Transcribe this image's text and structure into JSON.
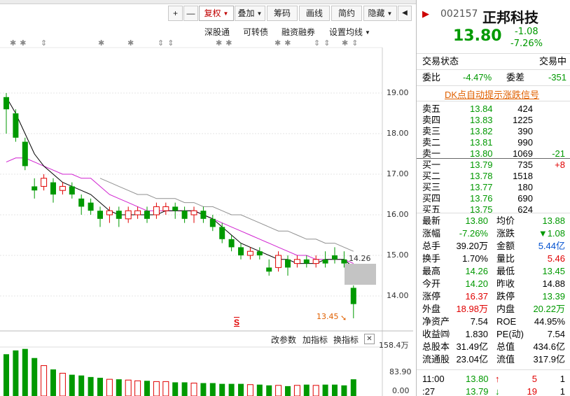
{
  "toolbar": {
    "plus": "+",
    "minus": "—",
    "restore": "复权",
    "overlay": "叠加",
    "chips": "筹码",
    "draw": "画线",
    "brief": "简约",
    "hide": "隐藏"
  },
  "subbar": {
    "sz_connect": "深股通",
    "convertible": "可转债",
    "margin": "融资融券",
    "ma_settings": "设置均线"
  },
  "chart": {
    "y_ticks": [
      "19.00",
      "18.00",
      "17.00",
      "16.00",
      "15.00",
      "14.00"
    ],
    "last_price_label": "14.26",
    "low_label": "13.45",
    "marker": "S",
    "volume_y_ticks": [
      "158.4万",
      "83.90",
      "0.00"
    ],
    "colors": {
      "up": "#e00000",
      "down": "#009900",
      "ma5": "#000000",
      "ma10": "#d020d0",
      "ma20": "#909090"
    },
    "candles": [
      {
        "o": 18.9,
        "c": 18.6,
        "h": 19.0,
        "l": 18.0,
        "up": false
      },
      {
        "o": 18.5,
        "c": 17.9,
        "h": 18.6,
        "l": 17.8,
        "up": false
      },
      {
        "o": 17.8,
        "c": 17.2,
        "h": 17.9,
        "l": 17.1,
        "up": false
      },
      {
        "o": 16.7,
        "c": 16.6,
        "h": 16.9,
        "l": 16.4,
        "up": false
      },
      {
        "o": 16.7,
        "c": 16.9,
        "h": 17.0,
        "l": 16.6,
        "up": true
      },
      {
        "o": 16.8,
        "c": 16.5,
        "h": 16.9,
        "l": 16.3,
        "up": false
      },
      {
        "o": 16.6,
        "c": 16.7,
        "h": 16.8,
        "l": 16.5,
        "up": true
      },
      {
        "o": 16.7,
        "c": 16.5,
        "h": 16.8,
        "l": 16.4,
        "up": false
      },
      {
        "o": 16.4,
        "c": 16.2,
        "h": 16.5,
        "l": 16.0,
        "up": false
      },
      {
        "o": 16.3,
        "c": 16.1,
        "h": 16.4,
        "l": 16.0,
        "up": false
      },
      {
        "o": 16.1,
        "c": 15.9,
        "h": 16.2,
        "l": 15.7,
        "up": false
      },
      {
        "o": 16.0,
        "c": 16.1,
        "h": 16.2,
        "l": 15.8,
        "up": true
      },
      {
        "o": 16.1,
        "c": 15.9,
        "h": 16.2,
        "l": 15.7,
        "up": false
      },
      {
        "o": 15.9,
        "c": 16.1,
        "h": 16.2,
        "l": 15.8,
        "up": true
      },
      {
        "o": 16.0,
        "c": 16.1,
        "h": 16.2,
        "l": 15.9,
        "up": true
      },
      {
        "o": 16.1,
        "c": 15.9,
        "h": 16.2,
        "l": 15.8,
        "up": false
      },
      {
        "o": 16.0,
        "c": 16.2,
        "h": 16.3,
        "l": 15.9,
        "up": true
      },
      {
        "o": 16.1,
        "c": 16.2,
        "h": 16.3,
        "l": 16.0,
        "up": true
      },
      {
        "o": 16.2,
        "c": 16.1,
        "h": 16.3,
        "l": 15.9,
        "up": false
      },
      {
        "o": 16.1,
        "c": 15.9,
        "h": 16.2,
        "l": 15.8,
        "up": false
      },
      {
        "o": 16.0,
        "c": 16.1,
        "h": 16.2,
        "l": 15.8,
        "up": true
      },
      {
        "o": 16.1,
        "c": 15.9,
        "h": 16.2,
        "l": 15.8,
        "up": false
      },
      {
        "o": 15.9,
        "c": 15.7,
        "h": 16.0,
        "l": 15.6,
        "up": false
      },
      {
        "o": 15.7,
        "c": 15.4,
        "h": 15.8,
        "l": 15.3,
        "up": false
      },
      {
        "o": 15.4,
        "c": 15.2,
        "h": 15.5,
        "l": 15.1,
        "up": false
      },
      {
        "o": 15.2,
        "c": 15.0,
        "h": 15.3,
        "l": 14.9,
        "up": false
      },
      {
        "o": 15.0,
        "c": 15.1,
        "h": 15.2,
        "l": 14.9,
        "up": true
      },
      {
        "o": 15.1,
        "c": 15.0,
        "h": 15.2,
        "l": 14.9,
        "up": false
      },
      {
        "o": 14.7,
        "c": 14.6,
        "h": 14.9,
        "l": 14.5,
        "up": false
      },
      {
        "o": 14.7,
        "c": 15.0,
        "h": 15.1,
        "l": 14.6,
        "up": true
      },
      {
        "o": 14.9,
        "c": 14.7,
        "h": 15.0,
        "l": 14.5,
        "up": false
      },
      {
        "o": 14.8,
        "c": 14.9,
        "h": 15.0,
        "l": 14.7,
        "up": true
      },
      {
        "o": 14.9,
        "c": 14.8,
        "h": 15.0,
        "l": 14.7,
        "up": false
      },
      {
        "o": 14.8,
        "c": 14.9,
        "h": 15.0,
        "l": 14.7,
        "up": true
      },
      {
        "o": 14.9,
        "c": 14.8,
        "h": 15.1,
        "l": 14.7,
        "up": false
      },
      {
        "o": 15.0,
        "c": 14.9,
        "h": 15.2,
        "l": 14.8,
        "up": false
      },
      {
        "o": 14.9,
        "c": 14.8,
        "h": 15.1,
        "l": 14.7,
        "up": false
      },
      {
        "o": 14.2,
        "c": 13.8,
        "h": 14.26,
        "l": 13.45,
        "up": false
      }
    ],
    "ma5": [
      18.9,
      18.5,
      18.0,
      17.5,
      17.2,
      17.0,
      16.8,
      16.7,
      16.6,
      16.5,
      16.3,
      16.1,
      16.0,
      16.0,
      16.0,
      16.0,
      16.0,
      16.1,
      16.1,
      16.1,
      16.1,
      16.0,
      15.9,
      15.7,
      15.5,
      15.3,
      15.2,
      15.1,
      15.0,
      14.9,
      14.9,
      14.8,
      14.8,
      14.8,
      14.9,
      14.9,
      14.9,
      14.7
    ],
    "ma10": [
      17.3,
      17.4,
      17.4,
      17.3,
      17.2,
      17.1,
      17.0,
      17.0,
      16.9,
      16.9,
      16.7,
      16.5,
      16.4,
      16.3,
      16.2,
      16.1,
      16.1,
      16.1,
      16.1,
      16.1,
      16.1,
      16.0,
      15.9,
      15.8,
      15.7,
      15.6,
      15.5,
      15.4,
      15.3,
      15.2,
      15.1,
      15.0,
      15.0,
      14.9,
      14.9,
      14.9,
      14.9,
      14.8
    ],
    "ma20": [
      null,
      null,
      null,
      null,
      null,
      null,
      null,
      null,
      null,
      null,
      16.9,
      16.8,
      16.7,
      16.6,
      16.5,
      16.5,
      16.4,
      16.4,
      16.4,
      16.3,
      16.3,
      16.2,
      16.2,
      16.1,
      16.0,
      16.0,
      15.9,
      15.8,
      15.7,
      15.6,
      15.6,
      15.5,
      15.4,
      15.4,
      15.3,
      15.3,
      15.2,
      15.1
    ],
    "volumes": [
      55,
      60,
      62,
      50,
      40,
      35,
      30,
      28,
      27,
      25,
      24,
      22,
      22,
      21,
      20,
      20,
      19,
      19,
      18,
      18,
      17,
      17,
      17,
      16,
      16,
      16,
      15,
      15,
      14,
      14,
      13,
      14,
      15,
      14,
      15,
      15,
      14,
      22
    ]
  },
  "vol_bar": {
    "change_params": "改参数",
    "add_indicator": "加指标",
    "swap_indicator": "换指标",
    "close": "✕"
  },
  "quote": {
    "code": "002157",
    "name": "正邦科技",
    "price": "13.80",
    "change": "-1.08",
    "change_pct": "-7.26%",
    "trade_status_label": "交易状态",
    "trade_status_value": "交易中",
    "weibi_label": "委比",
    "weibi_value": "-4.47%",
    "weicha_label": "委差",
    "weicha_value": "-351",
    "dk_link": "DK点自动提示涨跌信号"
  },
  "sell_orders": [
    {
      "label": "卖五",
      "price": "13.84",
      "vol": "424",
      "chg": ""
    },
    {
      "label": "卖四",
      "price": "13.83",
      "vol": "1225",
      "chg": ""
    },
    {
      "label": "卖三",
      "price": "13.82",
      "vol": "390",
      "chg": ""
    },
    {
      "label": "卖二",
      "price": "13.81",
      "vol": "990",
      "chg": ""
    },
    {
      "label": "卖一",
      "price": "13.80",
      "vol": "1069",
      "chg": "-21"
    }
  ],
  "buy_orders": [
    {
      "label": "买一",
      "price": "13.79",
      "vol": "735",
      "chg": "+8"
    },
    {
      "label": "买二",
      "price": "13.78",
      "vol": "1518",
      "chg": ""
    },
    {
      "label": "买三",
      "price": "13.77",
      "vol": "180",
      "chg": ""
    },
    {
      "label": "买四",
      "price": "13.76",
      "vol": "690",
      "chg": ""
    },
    {
      "label": "买五",
      "price": "13.75",
      "vol": "624",
      "chg": ""
    }
  ],
  "stats": [
    {
      "l1": "最新",
      "v1": "13.80",
      "c1": "green",
      "l2": "均价",
      "v2": "13.88",
      "c2": "green"
    },
    {
      "l1": "涨幅",
      "v1": "-7.26%",
      "c1": "green",
      "l2": "涨跌",
      "v2": "▼1.08",
      "c2": "green"
    },
    {
      "l1": "总手",
      "v1": "39.20万",
      "c1": "black",
      "l2": "金额",
      "v2": "5.44亿",
      "c2": "blue"
    },
    {
      "l1": "换手",
      "v1": "1.70%",
      "c1": "black",
      "l2": "量比",
      "v2": "5.46",
      "c2": "red"
    },
    {
      "l1": "最高",
      "v1": "14.26",
      "c1": "green",
      "l2": "最低",
      "v2": "13.45",
      "c2": "green"
    },
    {
      "l1": "今开",
      "v1": "14.20",
      "c1": "green",
      "l2": "昨收",
      "v2": "14.88",
      "c2": "black"
    },
    {
      "l1": "涨停",
      "v1": "16.37",
      "c1": "red",
      "l2": "跌停",
      "v2": "13.39",
      "c2": "green"
    },
    {
      "l1": "外盘",
      "v1": "18.98万",
      "c1": "red",
      "l2": "内盘",
      "v2": "20.22万",
      "c2": "green"
    },
    {
      "l1": "净资产",
      "v1": "7.54",
      "c1": "black",
      "l2": "ROE",
      "v2": "44.95%",
      "c2": "black"
    },
    {
      "l1": "收益㈣",
      "v1": "1.830",
      "c1": "black",
      "l2": "PE(动)",
      "v2": "7.54",
      "c2": "black"
    },
    {
      "l1": "总股本",
      "v1": "31.49亿",
      "c1": "black",
      "l2": "总值",
      "v2": "434.6亿",
      "c2": "black"
    },
    {
      "l1": "流通股",
      "v1": "23.04亿",
      "c1": "black",
      "l2": "流值",
      "v2": "317.9亿",
      "c2": "black"
    }
  ],
  "ticks": [
    {
      "time": "11:00",
      "price": "13.80",
      "arrow": "↑",
      "vol": "5",
      "n": "1"
    },
    {
      "time": ":27",
      "price": "13.79",
      "arrow": "↓",
      "vol": "19",
      "n": "1"
    }
  ]
}
